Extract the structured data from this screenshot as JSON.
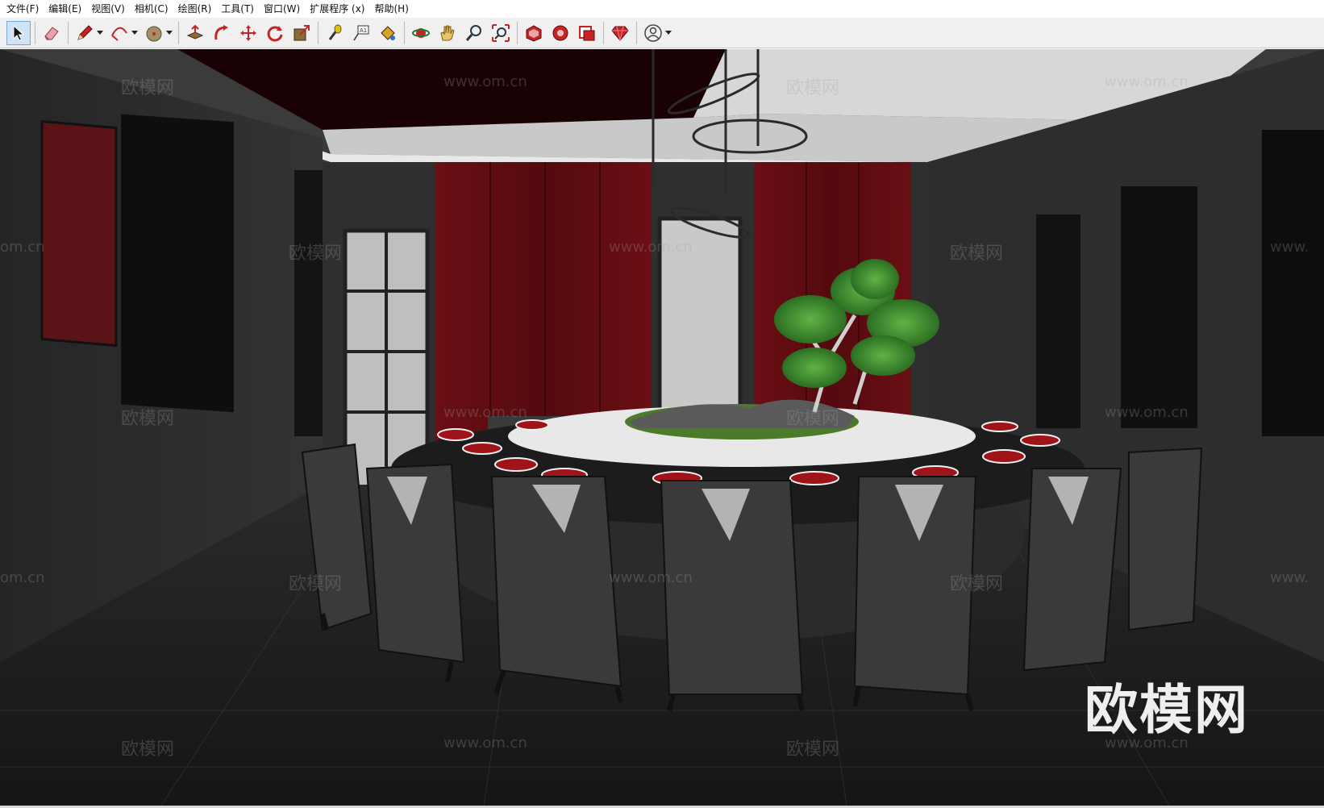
{
  "menu": [
    {
      "label": "文件(F)"
    },
    {
      "label": "编辑(E)"
    },
    {
      "label": "视图(V)"
    },
    {
      "label": "相机(C)"
    },
    {
      "label": "绘图(R)"
    },
    {
      "label": "工具(T)"
    },
    {
      "label": "窗口(W)"
    },
    {
      "label": "扩展程序 (x)"
    },
    {
      "label": "帮助(H)"
    }
  ],
  "toolbar": {
    "tools": [
      {
        "name": "select-icon",
        "active": true
      },
      {
        "name": "eraser-icon"
      },
      {
        "name": "pencil-icon"
      },
      {
        "name": "arc-icon"
      },
      {
        "name": "circle-icon"
      },
      {
        "name": "push-pull-icon"
      },
      {
        "name": "follow-me-icon"
      },
      {
        "name": "move-icon"
      },
      {
        "name": "rotate-icon"
      },
      {
        "name": "scale-icon"
      },
      {
        "name": "tape-measure-icon"
      },
      {
        "name": "text-icon"
      },
      {
        "name": "paint-bucket-icon"
      },
      {
        "name": "orbit-icon"
      },
      {
        "name": "pan-icon"
      },
      {
        "name": "zoom-icon"
      },
      {
        "name": "zoom-extents-icon"
      },
      {
        "name": "warehouse-icon"
      },
      {
        "name": "extension-warehouse-icon"
      },
      {
        "name": "layout-icon"
      },
      {
        "name": "ruby-console-icon"
      },
      {
        "name": "account-icon"
      }
    ]
  },
  "watermark": {
    "brand": "欧模网",
    "url": "www.om.cn",
    "url_partial": "om.cn",
    "url_partial2": "www."
  },
  "logo": {
    "text": "欧模网"
  },
  "colors": {
    "wall_dark": "#2b2b2b",
    "accent_red": "#5a0c10",
    "ceiling_dark_red": "#1a0204",
    "ceiling_white": "#d7d7d7",
    "table_top": "#e8e8e8",
    "plant_green": "#3f8a2e",
    "toolbar_bg": "#f0f0f0"
  }
}
